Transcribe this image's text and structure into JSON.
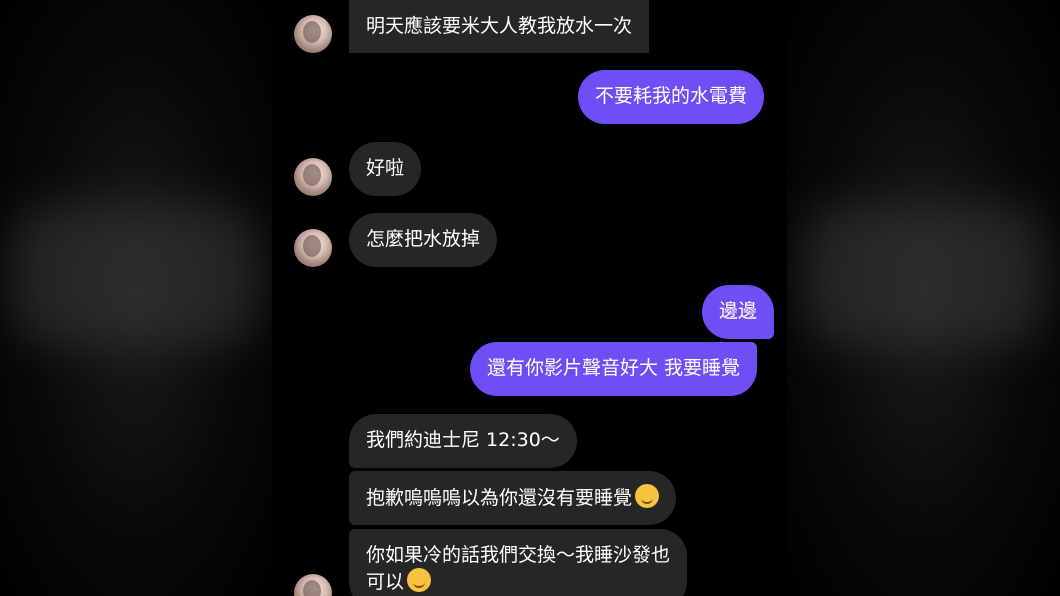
{
  "messages": [
    {
      "side": "in",
      "text": "明天應該要米大人教我放水一次"
    },
    {
      "side": "out",
      "text": "不要耗我的水電費"
    },
    {
      "side": "in",
      "text": "好啦"
    },
    {
      "side": "in",
      "text": "怎麼把水放掉"
    },
    {
      "side": "out",
      "text": "邊邊"
    },
    {
      "side": "out",
      "text": "還有你影片聲音好大 我要睡覺"
    },
    {
      "side": "in",
      "text": "我們約迪士尼 12:30～"
    },
    {
      "side": "in",
      "text": "抱歉嗚嗚嗚以為你還沒有要睡覺",
      "emoji": "crying-face-emoji"
    },
    {
      "side": "in",
      "text_line1": "你如果冷的話我們交換～我睡沙發也",
      "text_line2": "可以",
      "emoji": "hot-face-emoji"
    }
  ],
  "colors": {
    "incoming_bubble": "#262626",
    "outgoing_bubble": "#6f4ff5",
    "background": "#000000"
  }
}
